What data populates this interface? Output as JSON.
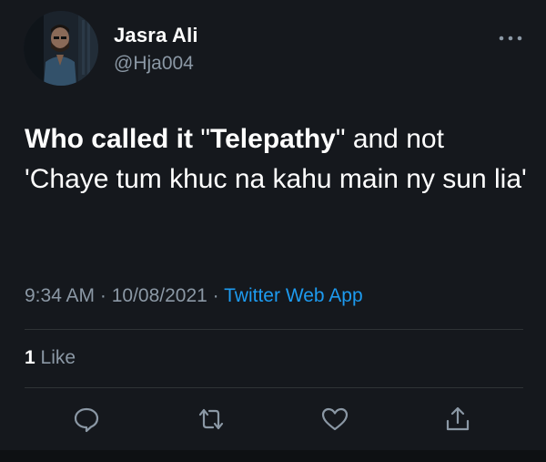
{
  "author": {
    "display_name": "Jasra Ali",
    "handle": "@Hja004",
    "avatar_icon": "profile-photo"
  },
  "tweet": {
    "text_parts": [
      {
        "text": "Who called it ",
        "bold": true
      },
      {
        "text": "\"",
        "bold": false
      },
      {
        "text": "Telepathy",
        "bold": true
      },
      {
        "text": "\" and not 'Chaye tum khuc na kahu main ny sun lia'",
        "bold": false
      }
    ],
    "time": "9:34 AM",
    "separator": " · ",
    "date": "10/08/2021",
    "source": "Twitter Web App"
  },
  "engagement": {
    "like_count": "1",
    "like_label": " Like"
  },
  "actions": [
    {
      "name": "reply",
      "icon": "reply-icon"
    },
    {
      "name": "retweet",
      "icon": "retweet-icon"
    },
    {
      "name": "like",
      "icon": "heart-icon"
    },
    {
      "name": "share",
      "icon": "share-icon"
    }
  ],
  "colors": {
    "background": "#15181d",
    "secondary_text": "#8b98a5",
    "link": "#1d9bf0",
    "divider": "#2f3336"
  }
}
